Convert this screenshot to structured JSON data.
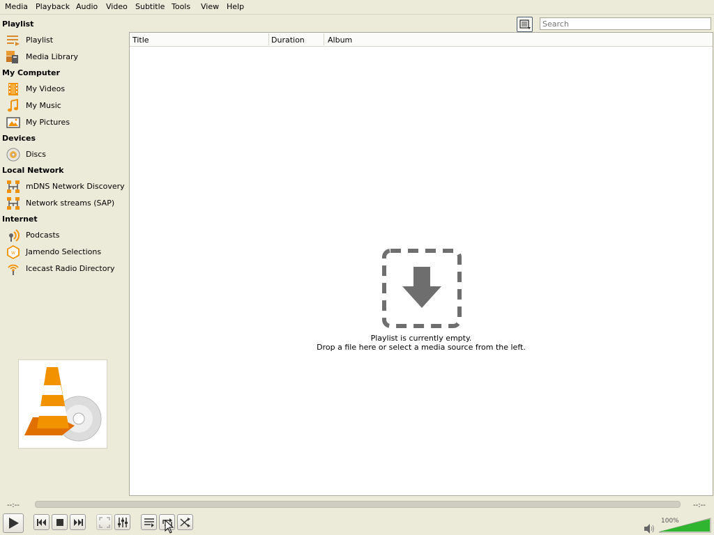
{
  "menu": [
    "Media",
    "Playback",
    "Audio",
    "Video",
    "Subtitle",
    "Tools",
    "View",
    "Help"
  ],
  "sidebar": {
    "sections": [
      {
        "title": "Playlist",
        "items": [
          {
            "label": "Playlist",
            "icon": "playlist-icon"
          },
          {
            "label": "Media Library",
            "icon": "media-library-icon"
          }
        ]
      },
      {
        "title": "My Computer",
        "items": [
          {
            "label": "My Videos",
            "icon": "film-icon"
          },
          {
            "label": "My Music",
            "icon": "music-note-icon"
          },
          {
            "label": "My Pictures",
            "icon": "picture-icon"
          }
        ]
      },
      {
        "title": "Devices",
        "items": [
          {
            "label": "Discs",
            "icon": "disc-icon"
          }
        ]
      },
      {
        "title": "Local Network",
        "items": [
          {
            "label": "mDNS Network Discovery",
            "icon": "network-icon"
          },
          {
            "label": "Network streams (SAP)",
            "icon": "network-icon"
          }
        ]
      },
      {
        "title": "Internet",
        "items": [
          {
            "label": "Podcasts",
            "icon": "podcast-icon"
          },
          {
            "label": "Jamendo Selections",
            "icon": "jamendo-icon"
          },
          {
            "label": "Icecast Radio Directory",
            "icon": "icecast-icon"
          }
        ]
      }
    ]
  },
  "search": {
    "placeholder": "Search"
  },
  "playlist": {
    "columns": [
      "Title",
      "Duration",
      "Album"
    ],
    "empty_line1": "Playlist is currently empty.",
    "empty_line2": "Drop a file here or select a media source from the left."
  },
  "controls": {
    "time_elapsed": "--:--",
    "time_total": "--:--",
    "volume": "100%",
    "volume_level": 1.0
  },
  "colors": {
    "accent_orange": "#f39200",
    "volume_green": "#2fb52f",
    "bg": "#ecead9"
  }
}
